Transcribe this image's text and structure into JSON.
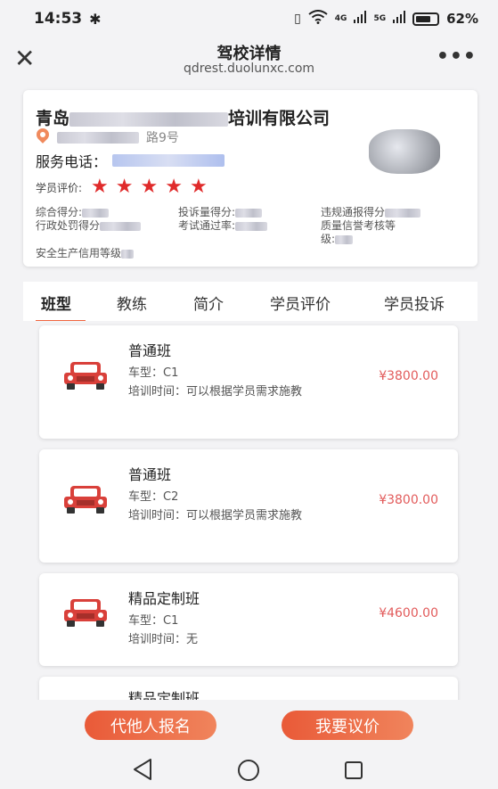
{
  "status_bar": {
    "time": "14:53",
    "network_4g": "4G",
    "network_5g": "5G",
    "battery": "62%"
  },
  "nav": {
    "title": "驾校详情",
    "url": "qdrest.duolunxc.com"
  },
  "school": {
    "name_prefix": "青岛",
    "name_suffix": "培训有限公司",
    "address_suffix": "路9号",
    "phone_label": "服务电话：",
    "rating_label": "学员评价:",
    "rating_stars": 5,
    "stats": {
      "total_score": "综合得分:",
      "complaint_score": "投诉量得分:",
      "violation_score": "违规通报得分",
      "admin_penalty": "行政处罚得分",
      "pass_rate": "考试通过率:",
      "quality_rating": "质量信誉考核等",
      "quality_rating_2": "级:",
      "safety_rating": "安全生产信用等级"
    }
  },
  "tabs": [
    {
      "label": "班型",
      "active": true
    },
    {
      "label": "教练",
      "active": false
    },
    {
      "label": "简介",
      "active": false
    },
    {
      "label": "学员评价",
      "active": false
    },
    {
      "label": "学员投诉",
      "active": false
    }
  ],
  "courses": [
    {
      "name": "普通班",
      "type": "车型：C1",
      "time": "培训时间：可以根据学员需求施教",
      "price": "¥3800.00"
    },
    {
      "name": "普通班",
      "type": "车型：C2",
      "time": "培训时间：可以根据学员需求施教",
      "price": "¥3800.00"
    },
    {
      "name": "精品定制班",
      "type": "车型：C1",
      "time": "培训时间：无",
      "price": "¥4600.00"
    },
    {
      "name": "精品定制班",
      "type": "",
      "time": "",
      "price": ""
    }
  ],
  "actions": {
    "register_for_others": "代他人报名",
    "negotiate_price": "我要议价"
  },
  "colors": {
    "accent": "#f0653e",
    "price": "#e25b5b",
    "star": "#e02b2b",
    "car": "#d9403a"
  }
}
